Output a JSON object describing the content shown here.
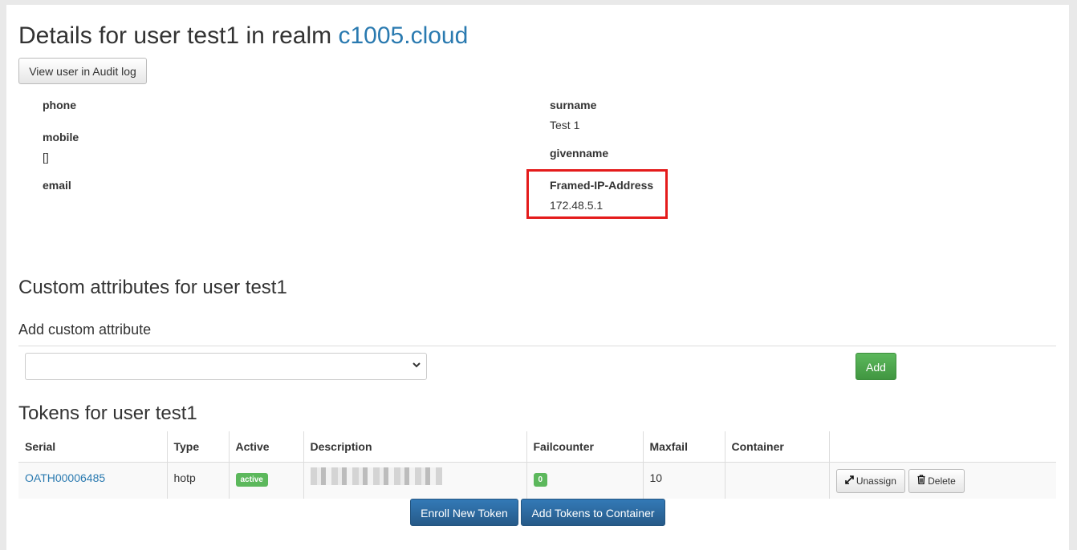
{
  "header": {
    "title_prefix": "Details for user test1 in realm",
    "realm_link": "c1005.cloud",
    "audit_button": "View user in Audit log"
  },
  "attributes": {
    "left": [
      {
        "key": "phone",
        "value": ""
      },
      {
        "key": "mobile",
        "value": "[]"
      },
      {
        "key": "email",
        "value": ""
      }
    ],
    "right": [
      {
        "key": "surname",
        "value": "Test 1"
      },
      {
        "key": "givenname",
        "value": ""
      },
      {
        "key": "Framed-IP-Address",
        "value": "172.48.5.1"
      }
    ]
  },
  "custom": {
    "heading": "Custom attributes for user test1",
    "subheading": "Add custom attribute",
    "select_value": "",
    "add_button": "Add"
  },
  "tokens": {
    "heading": "Tokens for user test1",
    "columns": [
      "Serial",
      "Type",
      "Active",
      "Description",
      "Failcounter",
      "Maxfail",
      "Container",
      ""
    ],
    "rows": [
      {
        "serial": "OATH00006485",
        "type": "hotp",
        "active": "active",
        "failcounter": "0",
        "maxfail": "10",
        "container": "",
        "unassign": "Unassign",
        "delete": "Delete"
      }
    ],
    "enroll_button": "Enroll New Token",
    "add_container_button": "Add Tokens to Container"
  },
  "colors": {
    "link": "#2a7ab0",
    "highlight": "#e41b1b",
    "success": "#5cb85c",
    "primary": "#337ab7"
  }
}
